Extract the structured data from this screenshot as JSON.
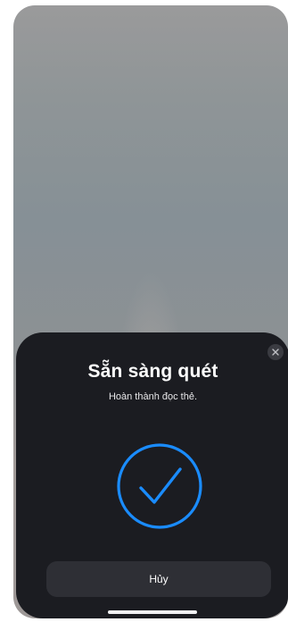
{
  "sheet": {
    "title": "Sẵn sàng quét",
    "subtitle": "Hoàn thành đọc thẻ.",
    "cancel_label": "Hủy",
    "close_icon": "close-icon",
    "status_icon": "checkmark-circle-icon"
  },
  "colors": {
    "sheet_background": "#1b1c21",
    "accent_blue": "#1a8cff",
    "button_background": "#2e2f35"
  }
}
